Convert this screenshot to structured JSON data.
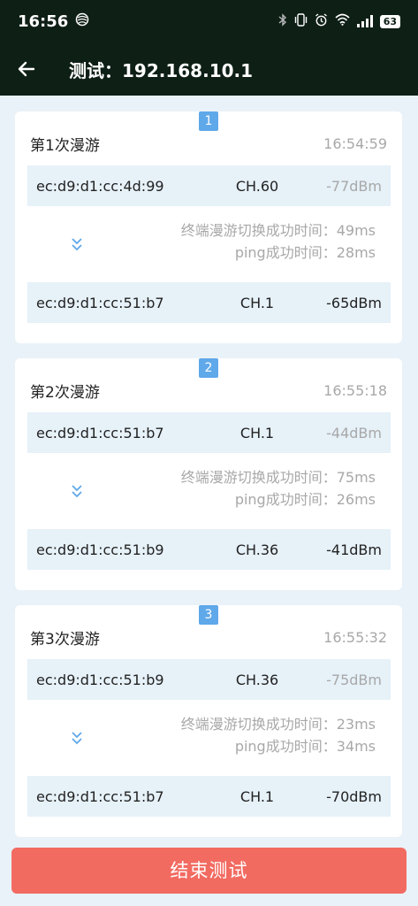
{
  "status_bar": {
    "time": "16:56",
    "battery": "63",
    "icons": [
      "carrier-icon",
      "bluetooth-icon",
      "vibrate-icon",
      "alarm-icon",
      "wifi-icon",
      "signal-icon",
      "battery-icon"
    ]
  },
  "app_bar": {
    "title": "测试：192.168.10.1",
    "back_icon": "back-arrow-icon"
  },
  "records": [
    {
      "index": "1",
      "title": "第1次漫游",
      "time": "16:54:59",
      "from": {
        "mac": "ec:d9:d1:cc:4d:99",
        "channel": "CH.60",
        "rssi": "-77dBm"
      },
      "switch_time": "终端漫游切换成功时间：49ms",
      "ping_time": "ping成功时间：28ms",
      "to": {
        "mac": "ec:d9:d1:cc:51:b7",
        "channel": "CH.1",
        "rssi": "-65dBm"
      }
    },
    {
      "index": "2",
      "title": "第2次漫游",
      "time": "16:55:18",
      "from": {
        "mac": "ec:d9:d1:cc:51:b7",
        "channel": "CH.1",
        "rssi": "-44dBm"
      },
      "switch_time": "终端漫游切换成功时间：75ms",
      "ping_time": "ping成功时间：26ms",
      "to": {
        "mac": "ec:d9:d1:cc:51:b9",
        "channel": "CH.36",
        "rssi": "-41dBm"
      }
    },
    {
      "index": "3",
      "title": "第3次漫游",
      "time": "16:55:32",
      "from": {
        "mac": "ec:d9:d1:cc:51:b9",
        "channel": "CH.36",
        "rssi": "-75dBm"
      },
      "switch_time": "终端漫游切换成功时间：23ms",
      "ping_time": "ping成功时间：34ms",
      "to": {
        "mac": "ec:d9:d1:cc:51:b7",
        "channel": "CH.1",
        "rssi": "-70dBm"
      }
    }
  ],
  "end_button_label": "结束测试",
  "colors": {
    "header_bg": "#0e1f16",
    "page_bg": "#e9f2f8",
    "row_bg": "#e6f1f8",
    "badge": "#5fa8ea",
    "accent_button": "#f26b61"
  }
}
